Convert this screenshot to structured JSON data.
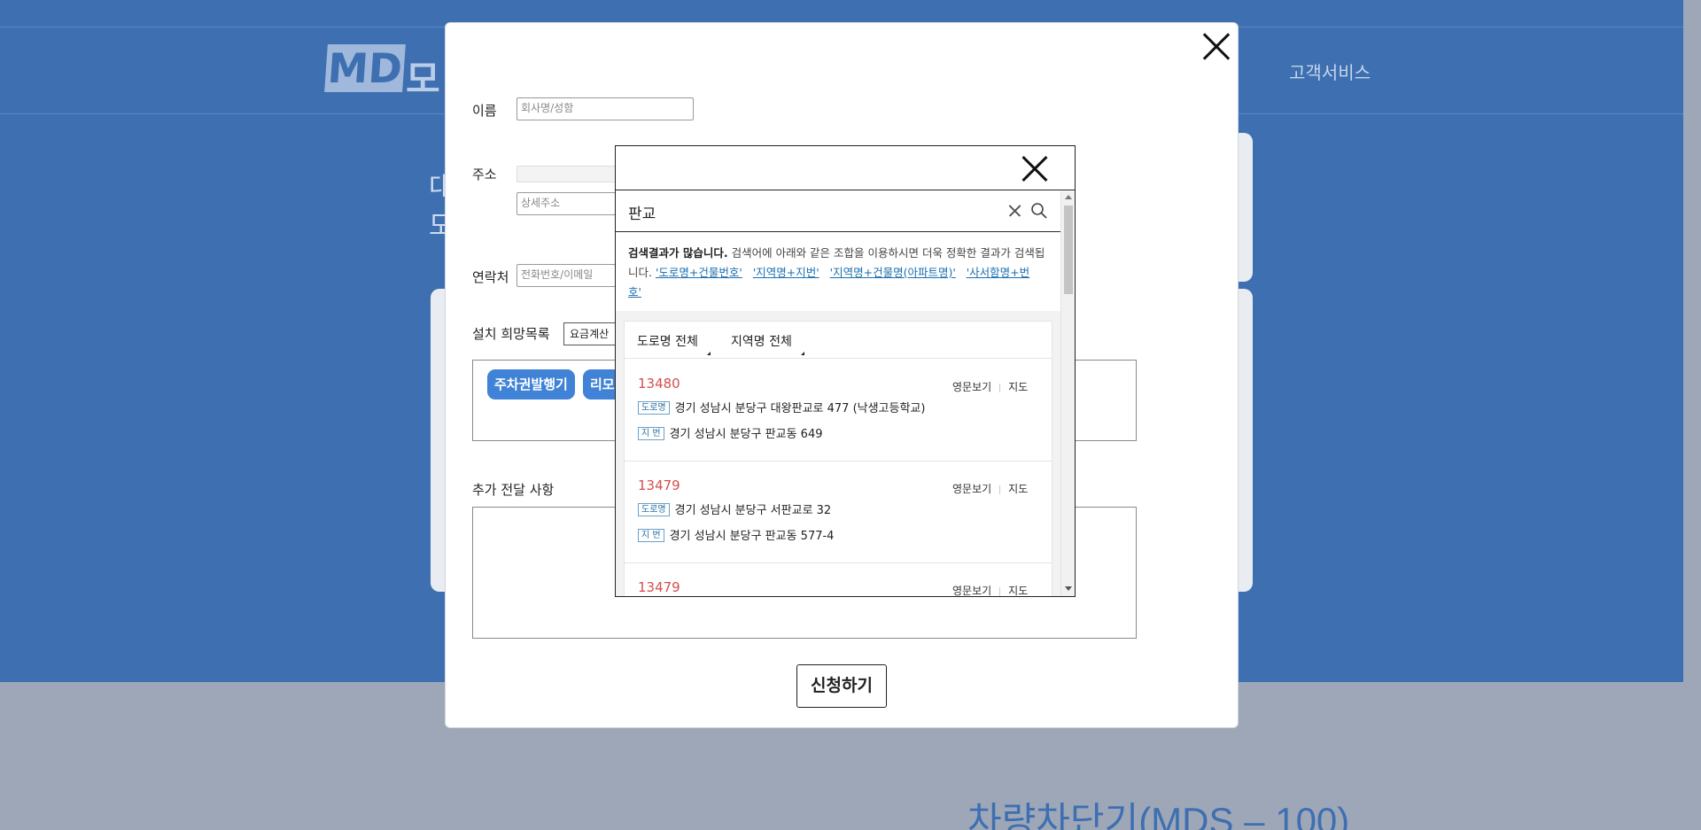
{
  "background": {
    "logo": "MD",
    "logo_suffix": "모",
    "nav_item": "고객서비스",
    "side_text": "대\n모",
    "product_title": "차량차단기(MDS – 100)"
  },
  "form": {
    "name_label": "이름",
    "name_placeholder": "회사명/성함",
    "address_label": "주소",
    "address_detail_placeholder": "상세주소",
    "contact_label": "연락처",
    "contact_placeholder": "전화번호/이메일",
    "wishlist_label": "설치 희망목록",
    "wishlist_select": "요금계산",
    "tags": [
      "주차권발행기",
      "리모"
    ],
    "extra_label": "추가 전달 사항",
    "submit_label": "신청하기"
  },
  "popup": {
    "search_value": "판교",
    "notice_bold": "검색결과가 많습니다.",
    "notice_text": "검색어에 아래와 같은 조합을 이용하시면 더욱 정확한 결과가 검색됩니다.",
    "hint_links": [
      "'도로명+건물번호'",
      "'지역명+지번'",
      "'지역명+건물명(아파트명)'",
      "'사서함명+번호'"
    ],
    "filters": [
      "도로명 전체",
      "지역명 전체"
    ],
    "results": [
      {
        "zip": "13480",
        "road_badge": "도로명",
        "road": "경기 성남시 분당구 대왕판교로 477 (낙생고등학교)",
        "jibun_badge": "지 번",
        "jibun": "경기 성남시 분당구 판교동 649",
        "english_link": "영문보기",
        "map_link": "지도"
      },
      {
        "zip": "13479",
        "road_badge": "도로명",
        "road": "경기 성남시 분당구 서판교로 32",
        "jibun_badge": "지 번",
        "jibun": "경기 성남시 분당구 판교동 577-4",
        "english_link": "영문보기",
        "map_link": "지도"
      },
      {
        "zip": "13479",
        "english_link": "영문보기",
        "map_link": "지도"
      }
    ]
  }
}
